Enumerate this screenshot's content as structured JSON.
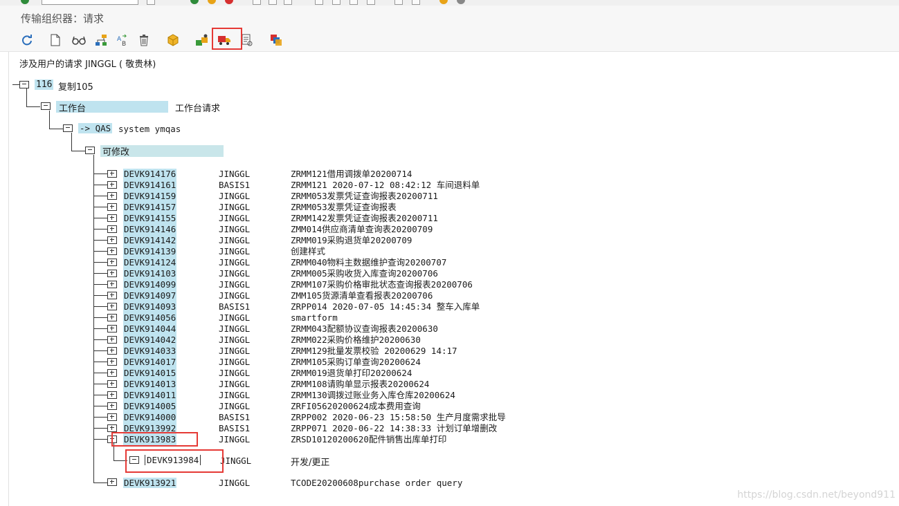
{
  "window": {
    "title": "传输组织器：请求"
  },
  "toolbar": {
    "buttons": [
      {
        "icon": "refresh-icon"
      },
      {
        "icon": "new-document-icon"
      },
      {
        "icon": "display-glasses-icon"
      },
      {
        "icon": "hierarchy-icon"
      },
      {
        "icon": "check-objects-icon"
      },
      {
        "icon": "delete-icon"
      },
      {
        "icon": "package-icon"
      },
      {
        "icon": "change-owner-icon"
      },
      {
        "icon": "release-truck-icon"
      },
      {
        "icon": "logs-icon"
      },
      {
        "icon": "transport-layers-icon"
      }
    ]
  },
  "header_text": "涉及用户的请求 JINGGL ( 敬贵林)",
  "tree": {
    "root": {
      "id": "116",
      "label": "复制105"
    },
    "level1": {
      "label": "工作台",
      "desc": "工作台请求"
    },
    "level2": {
      "label": "-> QAS",
      "desc": "system ymqas"
    },
    "level3": {
      "label": "可修改"
    },
    "requests": [
      {
        "id": "DEVK914176",
        "owner": "JINGGL",
        "desc": "ZRMM121借用调拨单20200714"
      },
      {
        "id": "DEVK914161",
        "owner": "BASIS1",
        "desc": "ZRMM121  2020-07-12  08:42:12 车间退料单"
      },
      {
        "id": "DEVK914159",
        "owner": "JINGGL",
        "desc": "ZRMM053发票凭证查询报表20200711"
      },
      {
        "id": "DEVK914157",
        "owner": "JINGGL",
        "desc": "ZRMM053发票凭证查询报表"
      },
      {
        "id": "DEVK914155",
        "owner": "JINGGL",
        "desc": "ZRMM142发票凭证查询报表20200711"
      },
      {
        "id": "DEVK914146",
        "owner": "JINGGL",
        "desc": "ZMM014供应商清单查询表20200709"
      },
      {
        "id": "DEVK914142",
        "owner": "JINGGL",
        "desc": "ZRMM019采购退货单20200709"
      },
      {
        "id": "DEVK914139",
        "owner": "JINGGL",
        "desc": "创建样式"
      },
      {
        "id": "DEVK914124",
        "owner": "JINGGL",
        "desc": "ZRMM040物料主数据维护查询20200707"
      },
      {
        "id": "DEVK914103",
        "owner": "JINGGL",
        "desc": "ZRMM005采购收货入库查询20200706"
      },
      {
        "id": "DEVK914099",
        "owner": "JINGGL",
        "desc": "ZRMM107采购价格审批状态查询报表20200706"
      },
      {
        "id": "DEVK914097",
        "owner": "JINGGL",
        "desc": "ZMM105货源清单查看报表20200706"
      },
      {
        "id": "DEVK914093",
        "owner": "BASIS1",
        "desc": "ZRPP014 2020-07-05  14:45:34 整车入库单"
      },
      {
        "id": "DEVK914056",
        "owner": "JINGGL",
        "desc": "smartform"
      },
      {
        "id": "DEVK914044",
        "owner": "JINGGL",
        "desc": "ZRMM043配额协议查询报表20200630"
      },
      {
        "id": "DEVK914042",
        "owner": "JINGGL",
        "desc": "ZRMM022采购价格维护20200630"
      },
      {
        "id": "DEVK914033",
        "owner": "JINGGL",
        "desc": "ZRMM129批量发票校验 20200629 14:17"
      },
      {
        "id": "DEVK914017",
        "owner": "JINGGL",
        "desc": "ZRMM105采购订单查询20200624"
      },
      {
        "id": "DEVK914015",
        "owner": "JINGGL",
        "desc": "ZRMM019退货单打印20200624"
      },
      {
        "id": "DEVK914013",
        "owner": "JINGGL",
        "desc": "ZRMM108请购单显示报表20200624"
      },
      {
        "id": "DEVK914011",
        "owner": "JINGGL",
        "desc": "ZRMM130调拨过账业务入库仓库20200624"
      },
      {
        "id": "DEVK914005",
        "owner": "JINGGL",
        "desc": "ZRFI05620200624成本费用查询"
      },
      {
        "id": "DEVK914000",
        "owner": "BASIS1",
        "desc": "ZRPP002 2020-06-23  15:58:50 生产月度需求批导"
      },
      {
        "id": "DEVK913992",
        "owner": "BASIS1",
        "desc": "ZRPP071  2020-06-22  14:38:33  计划订单增删改"
      },
      {
        "id": "DEVK913983",
        "owner": "JINGGL",
        "desc": "ZRSD10120200620配件销售出库单打印"
      }
    ],
    "task": {
      "id": "DEVK913984",
      "owner": "JINGGL",
      "desc": "开发/更正"
    },
    "last": {
      "id": "DEVK913921",
      "owner": "JINGGL",
      "desc": "TCODE20200608purchase order query"
    }
  },
  "watermark": "https://blog.csdn.net/beyond911"
}
